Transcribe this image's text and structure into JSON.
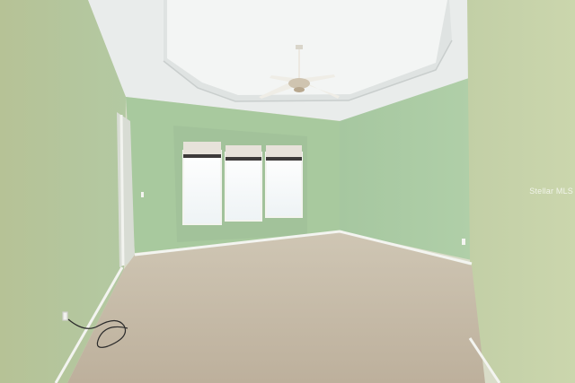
{
  "photo": {
    "subject": "empty-bedroom-interior",
    "features": [
      "tray-ceiling",
      "ceiling-fan",
      "three-windows-with-valances",
      "carpet-floor",
      "baseboards",
      "doorway",
      "power-cord"
    ],
    "colors": {
      "wall_green": "#a9cba1",
      "ceiling_white": "#f2f4f3",
      "carpet_beige": "#c4b9a6",
      "trim_white": "#f3f4f0"
    }
  },
  "watermark": {
    "text": "Stellar MLS"
  }
}
